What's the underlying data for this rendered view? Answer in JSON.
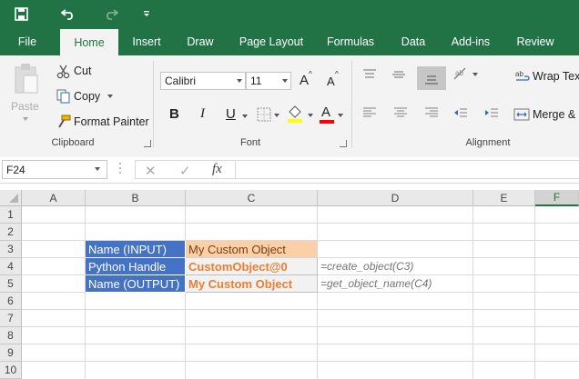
{
  "quick_access": {
    "save_icon": "save-icon",
    "undo_icon": "undo-icon",
    "redo_icon": "redo-icon",
    "customize_icon": "customize-icon"
  },
  "tabs": [
    "File",
    "Home",
    "Insert",
    "Draw",
    "Page Layout",
    "Formulas",
    "Data",
    "Add-ins",
    "Review"
  ],
  "active_tab": "Home",
  "ribbon": {
    "clipboard": {
      "paste": "Paste",
      "cut": "Cut",
      "copy": "Copy",
      "format_painter": "Format Painter",
      "label": "Clipboard"
    },
    "font": {
      "name": "Calibri",
      "size": "11",
      "label": "Font",
      "bold": "B",
      "italic": "I",
      "underline": "U",
      "grow": "A",
      "shrink": "A",
      "font_color": "A"
    },
    "alignment": {
      "wrap_text": "Wrap Text",
      "merge": "Merge &",
      "label": "Alignment"
    }
  },
  "formula_bar": {
    "name_box": "F24",
    "cancel": "✕",
    "enter": "✓",
    "fx": "fx",
    "formula": ""
  },
  "columns": [
    "A",
    "B",
    "C",
    "D",
    "E",
    "F"
  ],
  "rows": [
    "1",
    "2",
    "3",
    "4",
    "5",
    "6",
    "7",
    "8",
    "9",
    "10"
  ],
  "cells": {
    "B3": "Name (INPUT)",
    "C3": "My Custom Object",
    "B4": "Python Handle",
    "C4": "CustomObject@0",
    "D4": "=create_object(C3)",
    "B5": "Name (OUTPUT)",
    "C5": "My Custom Object",
    "D5": "=get_object_name(C4)"
  },
  "colors": {
    "excel_green": "#217346",
    "label_fill": "#4472c4",
    "input_fill": "#fbd0a7",
    "output_fill": "#f2f2f2",
    "output_text": "#ed7d31"
  }
}
